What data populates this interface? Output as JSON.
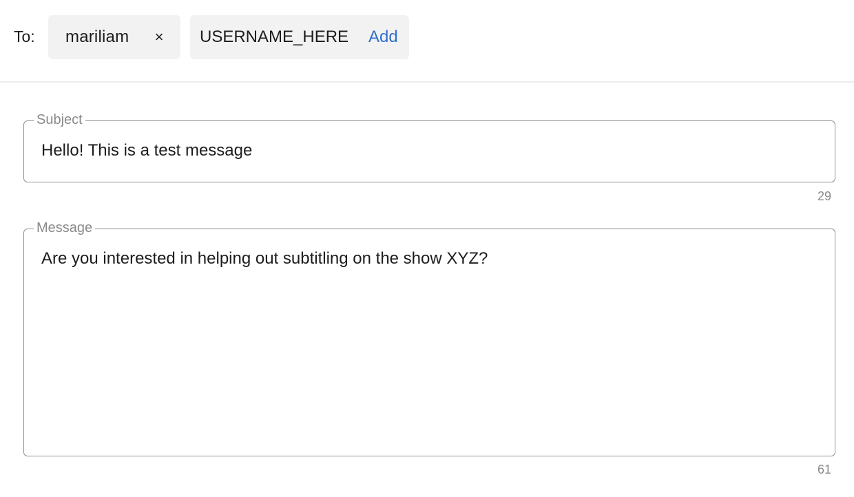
{
  "recipients": {
    "to_label": "To:",
    "chips": [
      {
        "name": "mariliam",
        "remove_symbol": "×"
      }
    ],
    "add_input": {
      "value": "USERNAME_HERE",
      "placeholder": ""
    },
    "add_label": "Add"
  },
  "subject": {
    "label": "Subject",
    "value": "Hello! This is a test message",
    "counter": "29"
  },
  "message": {
    "label": "Message",
    "value": "Are you interested in helping out subtitling on the show XYZ?",
    "counter": "61"
  },
  "colors": {
    "accent": "#2f6fcc",
    "chip_background": "#f2f2f2",
    "border": "#8f8f8f",
    "muted_text": "#8a8a8a"
  }
}
